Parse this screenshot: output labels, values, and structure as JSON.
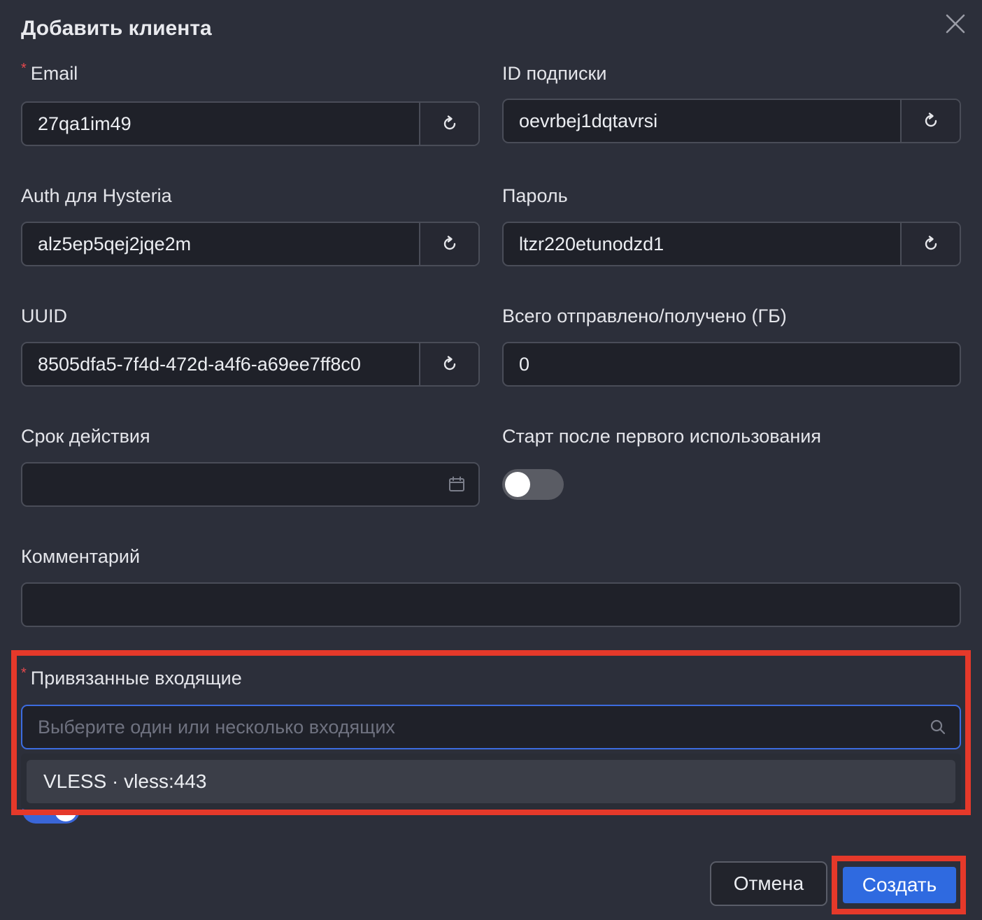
{
  "dialog": {
    "title": "Добавить клиента"
  },
  "fields": {
    "email": {
      "label": "Email",
      "value": "27qa1im49",
      "required": true
    },
    "subscription_id": {
      "label": "ID подписки",
      "value": "oevrbej1dqtavrsi"
    },
    "hysteria_auth": {
      "label": "Auth для Hysteria",
      "value": "alz5ep5qej2jqe2m"
    },
    "password": {
      "label": "Пароль",
      "value": "ltzr220etunodzd1"
    },
    "uuid": {
      "label": "UUID",
      "value": "8505dfa5-7f4d-472d-a4f6-a69ee7ff8c0"
    },
    "traffic": {
      "label": "Всего отправлено/получено (ГБ)",
      "value": "0"
    },
    "expiry": {
      "label": "Срок действия",
      "value": ""
    },
    "start_after_first_use": {
      "label": "Старт после первого использования",
      "enabled": false
    },
    "comment": {
      "label": "Комментарий",
      "value": ""
    },
    "inbounds": {
      "label": "Привязанные входящие",
      "required": true,
      "placeholder": "Выберите один или несколько входящих",
      "options": [
        "VLESS · vless:443"
      ]
    }
  },
  "footer": {
    "cancel_label": "Отмена",
    "create_label": "Создать"
  },
  "colors": {
    "background": "#2c2f3a",
    "input_bg": "#1f2129",
    "primary": "#2f6ae0",
    "highlight": "#e5392a",
    "required": "#e5484d"
  },
  "icons": {
    "close": "close-icon",
    "regenerate": "refresh-icon",
    "calendar": "calendar-icon",
    "search": "search-icon"
  }
}
